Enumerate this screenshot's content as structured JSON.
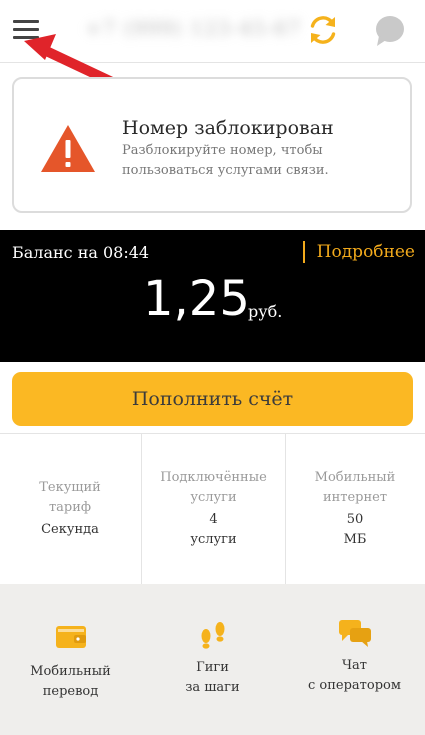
{
  "header": {
    "phone_number": "+7 (999) 123-45-67"
  },
  "alert": {
    "title": "Номер заблокирован",
    "text": "Разблокируйте номер, чтобы пользоваться услугами связи."
  },
  "balance": {
    "label": "Баланс на 08:44",
    "details_link": "Подробнее",
    "amount": "1,25",
    "currency": "руб."
  },
  "topup": {
    "label": "Пополнить счёт"
  },
  "stats": [
    {
      "label": "Текущий\nтариф",
      "value": "Секунда"
    },
    {
      "label": "Подключённые\nуслуги",
      "value": "4\nуслуги"
    },
    {
      "label": "Мобильный\nинтернет",
      "value": "50\nМБ"
    }
  ],
  "actions": [
    {
      "label": "Мобильный\nперевод",
      "icon": "wallet-icon"
    },
    {
      "label": "Гиги\nза шаги",
      "icon": "footprints-icon"
    },
    {
      "label": "Чат\nс оператором",
      "icon": "chat-bubbles-icon"
    }
  ],
  "colors": {
    "accent": "#fbb823",
    "link": "#f2aa1c",
    "warning": "#e5562a",
    "arrow": "#e0242a"
  }
}
